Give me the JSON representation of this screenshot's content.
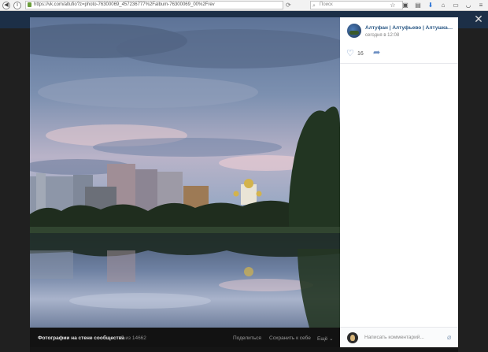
{
  "browser": {
    "url": "https://vk.com/altufio?z=photo-76300069_457236777%2Falbum-76300069_00%2Frev",
    "search_placeholder": "Поиск",
    "icons": [
      "back-icon",
      "info-icon",
      "lock-icon",
      "star-icon",
      "bookmark-icon",
      "save-icon",
      "download-icon",
      "home-icon",
      "chat-icon",
      "pocket-icon",
      "menu-icon"
    ]
  },
  "viewer": {
    "close_icon": "close-icon",
    "album_label": "Фотографии на стене сообщества",
    "counter": "5 из 14662",
    "share_label": "Поделиться",
    "save_label": "Сохранить к себе",
    "more_label": "Ещё"
  },
  "post": {
    "group_name": "Алтуфан | Алтуфьево | Алтушка | СВ...",
    "time": "сегодня в 12:08",
    "likes": "16",
    "comment_placeholder": "Написать комментарий..."
  },
  "colors": {
    "vk_link": "#2a5885",
    "vk_header": "#1c2f47",
    "accent_icon": "#6b8ec2"
  }
}
